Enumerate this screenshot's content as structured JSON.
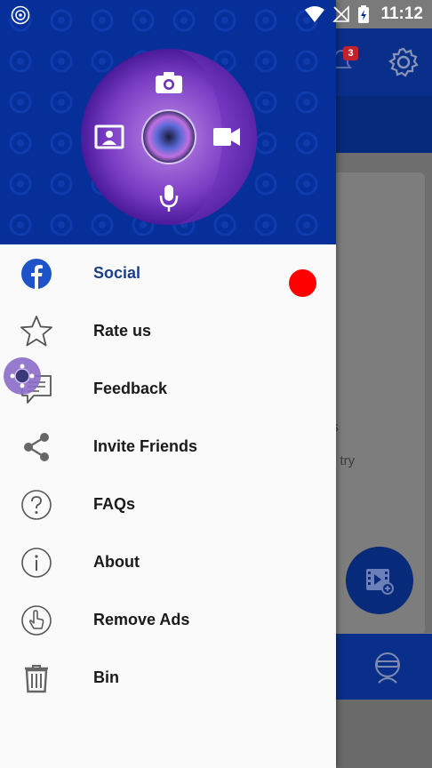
{
  "status_bar": {
    "time": "11:12"
  },
  "background": {
    "notification_count": "3",
    "text_line1": "is",
    "text_line2": "d try"
  },
  "menu": {
    "items": [
      {
        "label": "Social",
        "icon": "facebook-icon",
        "active": true
      },
      {
        "label": "Rate us",
        "icon": "star-icon"
      },
      {
        "label": "Feedback",
        "icon": "chat-icon"
      },
      {
        "label": "Invite Friends",
        "icon": "share-icon"
      },
      {
        "label": "FAQs",
        "icon": "help-icon"
      },
      {
        "label": "About",
        "icon": "info-icon"
      },
      {
        "label": "Remove Ads",
        "icon": "touch-icon"
      },
      {
        "label": "Bin",
        "icon": "trash-icon"
      }
    ]
  },
  "colors": {
    "header_blue": "#062f9a",
    "active_label": "#1a3f8c",
    "notification_dot": "#ff0000"
  }
}
